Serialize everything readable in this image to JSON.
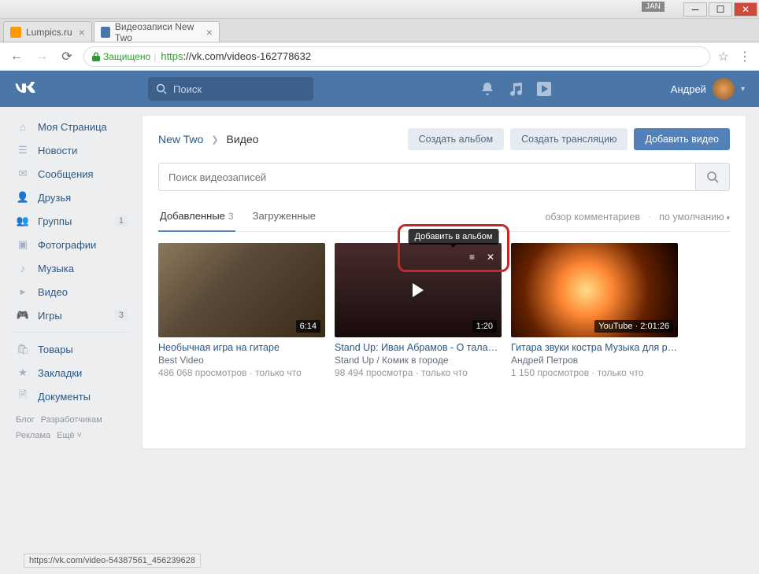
{
  "window": {
    "jan": "JAN"
  },
  "tabs": [
    {
      "title": "Lumpics.ru"
    },
    {
      "title": "Видеозаписи New Two"
    }
  ],
  "urlbar": {
    "secure": "Защищено",
    "proto": "https",
    "rest": "://vk.com/videos-162778632"
  },
  "vk_header": {
    "search_placeholder": "Поиск",
    "user_name": "Андрей"
  },
  "sidebar": {
    "items": [
      {
        "label": "Моя Страница",
        "icon": "home"
      },
      {
        "label": "Новости",
        "icon": "news"
      },
      {
        "label": "Сообщения",
        "icon": "msg"
      },
      {
        "label": "Друзья",
        "icon": "friends"
      },
      {
        "label": "Группы",
        "icon": "groups",
        "badge": "1"
      },
      {
        "label": "Фотографии",
        "icon": "photos"
      },
      {
        "label": "Музыка",
        "icon": "music"
      },
      {
        "label": "Видео",
        "icon": "video"
      },
      {
        "label": "Игры",
        "icon": "games",
        "badge": "3"
      }
    ],
    "items2": [
      {
        "label": "Товары",
        "icon": "market"
      },
      {
        "label": "Закладки",
        "icon": "fav"
      },
      {
        "label": "Документы",
        "icon": "docs"
      }
    ],
    "footer": [
      "Блог",
      "Разработчикам",
      "Реклама",
      "Ещё ˅"
    ]
  },
  "breadcrumb": {
    "group": "New Two",
    "current": "Видео"
  },
  "actions": {
    "create_album": "Создать альбом",
    "create_stream": "Создать трансляцию",
    "add_video": "Добавить видео"
  },
  "search": {
    "placeholder": "Поиск видеозаписей"
  },
  "content_tabs": {
    "added": "Добавленные",
    "added_count": "3",
    "uploaded": "Загруженные",
    "comments": "обзор комментариев",
    "sort": "по умолчанию"
  },
  "tooltip": "Добавить в альбом",
  "videos": [
    {
      "duration": "6:14",
      "title": "Необычная игра на гитаре",
      "source": "Best Video",
      "meta": "486 068 просмотров · только что"
    },
    {
      "duration": "1:20",
      "title": "Stand Up: Иван Абрамов - О таланте иг…",
      "source": "Stand Up / Комик в городе",
      "meta": "98 494 просмотра · только что"
    },
    {
      "duration": "YouTube · 2:01:26",
      "title": "Гитара звуки костра Музыка для разм…",
      "source": "Андрей Петров",
      "meta": "1 150 просмотров · только что"
    }
  ],
  "status": "https://vk.com/video-54387561_456239628"
}
